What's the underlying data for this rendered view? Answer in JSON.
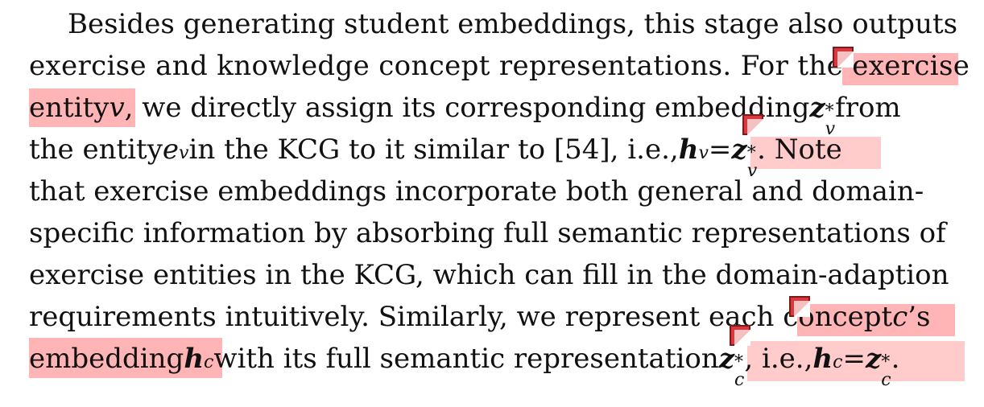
{
  "lines": [
    "Besides generating student embeddings, this stage also outputs",
    "exercise and knowledge concept representations. For the exercise",
    "entity v, we directly assign its corresponding embedding z*v from",
    "the entity ev in the KCG to it similar to [54], i.e., hv = z*v. Note",
    "that exercise embeddings incorporate both general and domain-",
    "specific information by absorbing full semantic representations of",
    "exercise entities in the KCG, which can fill in the domain-adaption",
    "requirements intuitively. Similarly, we represent each concept c's",
    "embedding hc with its full semantic representation z*c, i.e., hc = z*c."
  ],
  "segments": {
    "l3a": "entity ",
    "l3v": "v",
    "l3b": ", we directly assign its corresponding embedding ",
    "l3z": "z",
    "l3sup": "*",
    "l3sub": "v",
    "l3c": " from",
    "l4a": "the entity ",
    "l4e": "e",
    "l4esub": "v",
    "l4b": " in the KCG to it similar to [54], i.e., ",
    "l4h": "h",
    "l4hsub": "v",
    "l4eq": " = ",
    "l4z": "z",
    "l4zsup": "*",
    "l4zsub": "v",
    "l4c": ". Note",
    "l9a": "embedding ",
    "l9h": "h",
    "l9hsub": "c",
    "l9b": " with its full semantic representation ",
    "l9z": "z",
    "l9zsup": "*",
    "l9zsub": "c",
    "l9c": ", i.e., ",
    "l9h2": "h",
    "l9h2sub": "c",
    "l9eq": " = ",
    "l9z2": "z",
    "l9z2sup": "*",
    "l9z2sub": "c",
    "l9d": ".",
    "l8a": "requirements intuitively. Similarly, we represent each concept ",
    "l8c": "c",
    "l8b": "’s"
  },
  "annotation_color": "#d9393e",
  "highlight_color": "#ff7878"
}
